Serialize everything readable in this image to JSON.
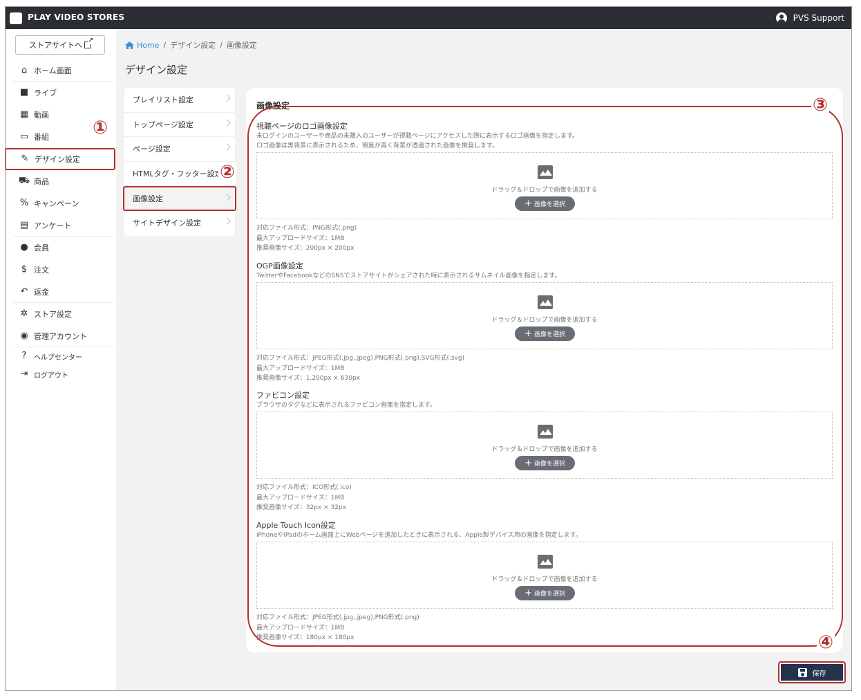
{
  "app": {
    "brand": "PLAY VIDEO STORES",
    "logo_text": "PLAY VIDEO STORES",
    "user": "PVS Support"
  },
  "sidebar": {
    "store_button": "ストアサイトへ",
    "items": [
      {
        "label": "ホーム画面",
        "icon": "home-icon",
        "glyph": "⌂"
      },
      {
        "label": "ライブ",
        "icon": "video-camera-icon",
        "glyph": "■"
      },
      {
        "label": "動画",
        "icon": "clapperboard-icon",
        "glyph": "▦"
      },
      {
        "label": "番組",
        "icon": "monitor-icon",
        "glyph": "▭"
      },
      {
        "label": "デザイン設定",
        "icon": "brush-icon",
        "glyph": "✎"
      },
      {
        "label": "商品",
        "icon": "cart-icon",
        "glyph": "⛟"
      },
      {
        "label": "キャンペーン",
        "icon": "percent-icon",
        "glyph": "%"
      },
      {
        "label": "アンケート",
        "icon": "chat-icon",
        "glyph": "▤"
      },
      {
        "label": "会員",
        "icon": "people-icon",
        "glyph": "●"
      },
      {
        "label": "注文",
        "icon": "dollar-icon",
        "glyph": "$"
      },
      {
        "label": "返金",
        "icon": "reply-icon",
        "glyph": "↶"
      },
      {
        "label": "ストア設定",
        "icon": "gear-icon",
        "glyph": "✲"
      },
      {
        "label": "管理アカウント",
        "icon": "account-icon",
        "glyph": "◉"
      },
      {
        "label": "ヘルプセンター",
        "icon": "help-icon",
        "glyph": "?"
      },
      {
        "label": "ログアウト",
        "icon": "logout-icon",
        "glyph": "⇥"
      }
    ]
  },
  "breadcrumb": {
    "home": "Home",
    "level1": "デザイン設定",
    "level2": "画像設定"
  },
  "page_title": "デザイン設定",
  "submenu": [
    "プレイリスト設定",
    "トップページ設定",
    "ページ設定",
    "HTMLタグ・フッター設定",
    "画像設定",
    "サイトデザイン設定"
  ],
  "panel": {
    "title": "画像設定",
    "dropzone_text": "ドラッグ＆ドロップで画像を追加する",
    "select_button": "画像を選択",
    "sections": [
      {
        "title": "視聴ページのロゴ画像設定",
        "desc": [
          "未ログインのユーザーや商品の未購入のユーザーが視聴ページにアクセスした際に表示するロゴ画像を指定します。",
          "ロゴ画像は黒背景に表示されるため、明度が高く背景が透過された画像を推奨します。"
        ],
        "specs": [
          "対応ファイル形式：PNG形式(.png)",
          "最大アップロードサイズ：1MB",
          "推奨画像サイズ：200px × 200px"
        ]
      },
      {
        "title": "OGP画像設定",
        "desc": [
          "TwitterやFacebookなどのSNSでストアサイトがシェアされた時に表示されるサムネイル画像を指定します。"
        ],
        "specs": [
          "対応ファイル形式：JPEG形式(.jpg,.jpeg),PNG形式(.png),SVG形式(.svg)",
          "最大アップロードサイズ：1MB",
          "推奨画像サイズ：1,200px × 630px"
        ]
      },
      {
        "title": "ファビコン設定",
        "desc": [
          "ブラウザのタグなどに表示されるファビコン画像を指定します。"
        ],
        "specs": [
          "対応ファイル形式：ICO形式(.ico)",
          "最大アップロードサイズ：1MB",
          "推奨画像サイズ：32px × 32px"
        ]
      },
      {
        "title": "Apple Touch Icon設定",
        "desc": [
          "iPhoneやiPadのホーム画面上にWebページを追加したときに表示される、Apple製デバイス用の画像を指定します。"
        ],
        "specs": [
          "対応ファイル形式：JPEG形式(.jpg,.jpeg),PNG形式(.png)",
          "最大アップロードサイズ：1MB",
          "推奨画像サイズ：180px × 180px"
        ]
      }
    ]
  },
  "save_button": "保存",
  "annotations": [
    "①",
    "②",
    "③",
    "④"
  ],
  "colors": {
    "topbar": "#2b2e33",
    "highlight": "#b3302d",
    "save": "#24324a",
    "link": "#3d8ad6"
  }
}
